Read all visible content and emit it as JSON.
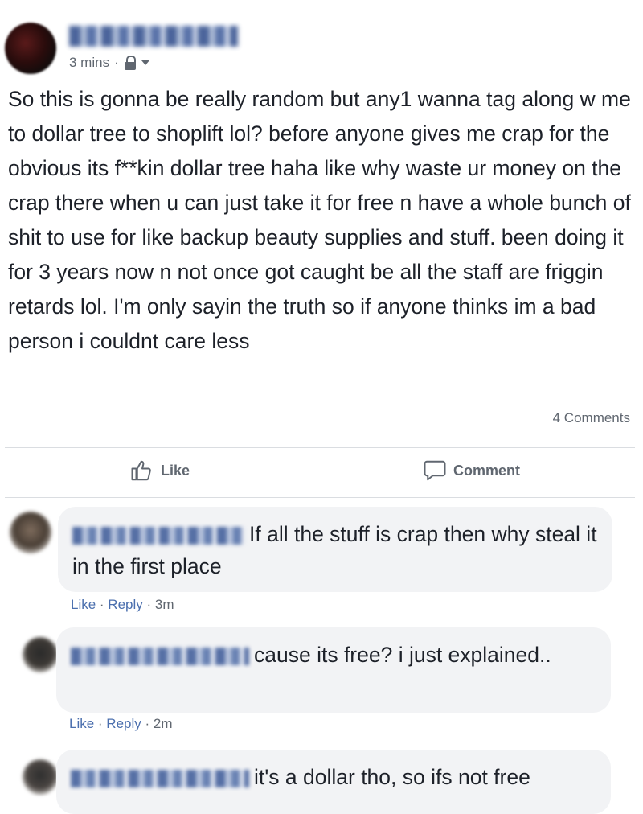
{
  "post": {
    "time": "3 mins",
    "separator": "·",
    "privacy_icon": "lock-icon",
    "text": "So this is gonna be really random but any1 wanna tag along w me to dollar tree to shoplift lol? before anyone gives me crap for the obvious its f**kin dollar tree haha like why waste ur money on the crap there when u can just take it for free n have a whole bunch of shit to use for like backup beauty supplies and stuff. been doing it for 3 years now n not once got caught be all the staff are friggin retards lol. I'm only sayin the truth so if anyone thinks im a bad person i couldnt care less",
    "comments_count": "4 Comments"
  },
  "actions": {
    "like_label": "Like",
    "comment_label": "Comment"
  },
  "comments": [
    {
      "text": "If all the stuff is crap then why steal it in the first place",
      "like": "Like",
      "reply": "Reply",
      "time": "3m"
    },
    {
      "text": "cause its free? i just explained..",
      "like": "Like",
      "reply": "Reply",
      "time": "2m"
    },
    {
      "text": "it's a dollar tho, so ifs not free"
    }
  ],
  "colors": {
    "text": "#1d2129",
    "muted": "#606770",
    "bubble": "#f2f3f5",
    "link": "#4b6fae"
  }
}
